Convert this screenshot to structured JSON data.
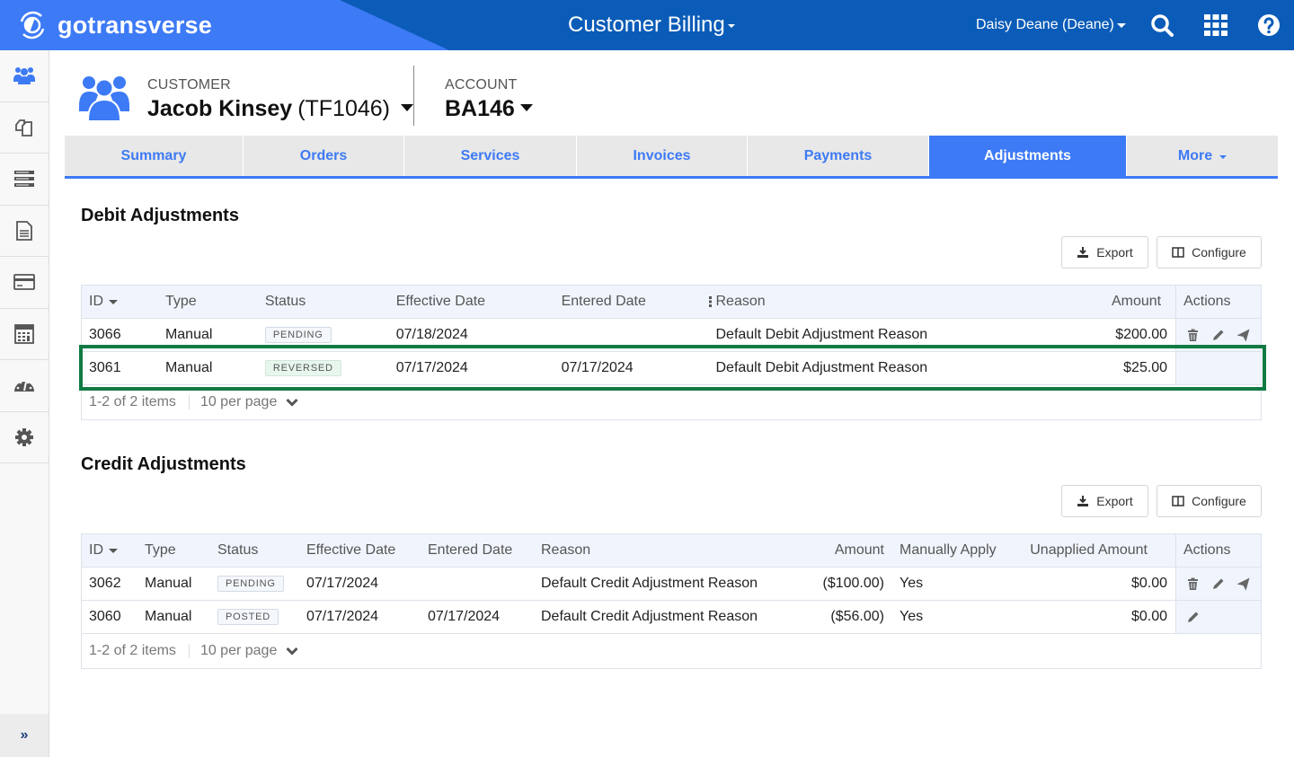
{
  "topbar": {
    "brand": "gotransverse",
    "app_title": "Customer Billing",
    "user": "Daisy Deane (Deane)",
    "icons": [
      "search-icon",
      "apps-grid-icon",
      "help-icon"
    ]
  },
  "sidebar": {
    "items": [
      {
        "name": "customers",
        "icon": "users-icon",
        "active": true
      },
      {
        "name": "orders",
        "icon": "documents-icon"
      },
      {
        "name": "services",
        "icon": "server-list-icon"
      },
      {
        "name": "invoices",
        "icon": "file-text-icon"
      },
      {
        "name": "payments",
        "icon": "credit-card-icon"
      },
      {
        "name": "accounting",
        "icon": "calculator-icon"
      },
      {
        "name": "dashboard",
        "icon": "speedometer-icon"
      },
      {
        "name": "settings",
        "icon": "gear-icon"
      }
    ],
    "expand_label": "»"
  },
  "customer": {
    "label": "CUSTOMER",
    "name": "Jacob Kinsey",
    "code": "(TF1046)"
  },
  "account": {
    "label": "ACCOUNT",
    "id": "BA146"
  },
  "tabs": [
    {
      "label": "Summary"
    },
    {
      "label": "Orders"
    },
    {
      "label": "Services"
    },
    {
      "label": "Invoices"
    },
    {
      "label": "Payments"
    },
    {
      "label": "Adjustments",
      "active": true
    },
    {
      "label": "More"
    }
  ],
  "debit": {
    "title": "Debit Adjustments",
    "export_label": "Export",
    "configure_label": "Configure",
    "columns": [
      "ID",
      "Type",
      "Status",
      "Effective Date",
      "Entered Date",
      "Reason",
      "Amount",
      "Actions"
    ],
    "rows": [
      {
        "id": "3066",
        "type": "Manual",
        "status": "PENDING",
        "effective": "07/18/2024",
        "entered": "",
        "reason": "Default Debit Adjustment Reason",
        "amount": "$200.00",
        "actions": [
          "delete",
          "edit",
          "post"
        ]
      },
      {
        "id": "3061",
        "type": "Manual",
        "status": "REVERSED",
        "effective": "07/17/2024",
        "entered": "07/17/2024",
        "reason": "Default Debit Adjustment Reason",
        "amount": "$25.00",
        "actions": [],
        "highlighted": true
      }
    ],
    "pager": {
      "summary": "1-2 of 2 items",
      "per_page": "10 per page"
    }
  },
  "credit": {
    "title": "Credit Adjustments",
    "export_label": "Export",
    "configure_label": "Configure",
    "columns": [
      "ID",
      "Type",
      "Status",
      "Effective Date",
      "Entered Date",
      "Reason",
      "Amount",
      "Manually Apply",
      "Unapplied Amount",
      "Actions"
    ],
    "rows": [
      {
        "id": "3062",
        "type": "Manual",
        "status": "PENDING",
        "effective": "07/17/2024",
        "entered": "",
        "reason": "Default Credit Adjustment Reason",
        "amount": "($100.00)",
        "manual": "Yes",
        "unapplied": "$0.00",
        "actions": [
          "delete",
          "edit",
          "post"
        ]
      },
      {
        "id": "3060",
        "type": "Manual",
        "status": "POSTED",
        "effective": "07/17/2024",
        "entered": "07/17/2024",
        "reason": "Default Credit Adjustment Reason",
        "amount": "($56.00)",
        "manual": "Yes",
        "unapplied": "$0.00",
        "actions": [
          "edit"
        ]
      }
    ],
    "pager": {
      "summary": "1-2 of 2 items",
      "per_page": "10 per page"
    }
  },
  "colors": {
    "brand_blue": "#3d7af5",
    "topbar_dark": "#0b5cb8",
    "highlight_green": "#117a43"
  }
}
